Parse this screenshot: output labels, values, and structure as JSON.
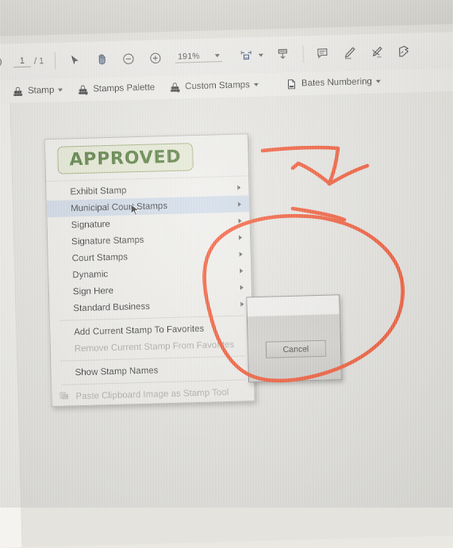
{
  "app": {
    "title": "PDF Annotator - Stamp tool menu"
  },
  "toolbar": {
    "download_icon": "download-icon",
    "page_current": "1",
    "page_separator": "/ 1",
    "select_icon": "cursor-arrow-icon",
    "hand_icon": "hand-pan-icon",
    "zoom_out_icon": "zoom-out-icon",
    "zoom_in_icon": "zoom-in-icon",
    "zoom_level": "191%",
    "zoom_caret_icon": "chevron-down-icon",
    "page_layout_icon": "page-layout-icon",
    "page_layout_caret_icon": "chevron-down-icon",
    "save_icon": "save-to-disk-icon",
    "comment_icon": "comment-bubble-icon",
    "highlight_icon": "highlighter-pen-icon",
    "signature_icon": "signature-pen-icon",
    "stamp_icon": "stamp-icon"
  },
  "subtoolbar": {
    "items": [
      {
        "label": "Stamp",
        "icon": "stamp-icon",
        "has_caret": true
      },
      {
        "label": "Stamps Palette",
        "icon": "stamps-palette-icon",
        "has_caret": false
      },
      {
        "label": "Custom Stamps",
        "icon": "custom-stamps-icon",
        "has_caret": true
      },
      {
        "label": "Bates Numbering",
        "icon": "bates-numbering-icon",
        "has_caret": true
      }
    ]
  },
  "menu": {
    "preview_stamp_label": "APPROVED",
    "preview_stamp_color": "#3f6b22",
    "preview_stamp_fill": "#e6ead2",
    "preview_stamp_border": "#9aa871",
    "highlight_color": "#ccd9e8",
    "groups": [
      {
        "items": [
          {
            "label": "Exhibit Stamp",
            "submenu": true,
            "highlighted": false,
            "disabled": false
          },
          {
            "label": "Municipal Court Stamps",
            "submenu": true,
            "highlighted": true,
            "disabled": false
          },
          {
            "label": "Signature",
            "submenu": true,
            "highlighted": false,
            "disabled": false
          },
          {
            "label": "Signature Stamps",
            "submenu": true,
            "highlighted": false,
            "disabled": false
          },
          {
            "label": "Court Stamps",
            "submenu": true,
            "highlighted": false,
            "disabled": false
          },
          {
            "label": "Dynamic",
            "submenu": true,
            "highlighted": false,
            "disabled": false
          },
          {
            "label": "Sign Here",
            "submenu": true,
            "highlighted": false,
            "disabled": false
          },
          {
            "label": "Standard Business",
            "submenu": true,
            "highlighted": false,
            "disabled": false
          }
        ]
      },
      {
        "items": [
          {
            "label": "Add Current Stamp To Favorites",
            "submenu": false,
            "highlighted": false,
            "disabled": false
          },
          {
            "label": "Remove Current Stamp From Favorites",
            "submenu": false,
            "highlighted": false,
            "disabled": true
          }
        ]
      },
      {
        "items": [
          {
            "label": "Show Stamp Names",
            "submenu": false,
            "highlighted": false,
            "disabled": false
          }
        ]
      },
      {
        "items": [
          {
            "label": "Paste Clipboard Image as Stamp Tool",
            "submenu": false,
            "highlighted": false,
            "disabled": true,
            "icon": "clipboard-image-icon"
          }
        ]
      }
    ]
  },
  "dialog": {
    "cancel_label": "Cancel"
  },
  "annotations": {
    "ink_color": "#f5431a",
    "marks": [
      {
        "name": "check-arrow-mark",
        "description": "hand drawn arrow / check mark above the dialog"
      },
      {
        "name": "circle-mark",
        "description": "hand drawn ellipse circling the modal dialog"
      }
    ]
  }
}
